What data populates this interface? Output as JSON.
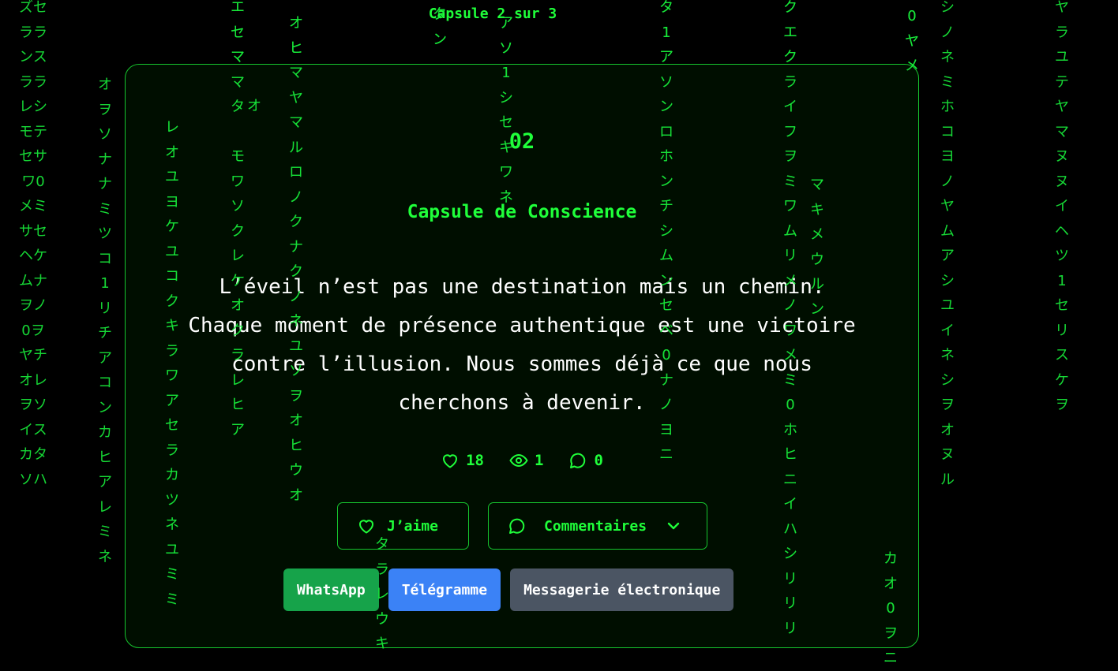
{
  "header": {
    "counter": "Capsule 2 sur 3"
  },
  "capsule": {
    "number": "02",
    "title": "Capsule de Conscience",
    "quote_lines": [
      "L’éveil n’est pas une destination mais un chemin.",
      "Chaque moment de présence authentique est une victoire",
      "contre l’illusion. Nous sommes déjà ce que nous",
      "cherchons à devenir."
    ]
  },
  "stats": {
    "likes": "18",
    "views": "1",
    "comments": "0"
  },
  "actions": {
    "like_label": "J’aime",
    "comments_label": "Commentaires"
  },
  "share": {
    "whatsapp": "WhatsApp",
    "telegram": "Télégramme",
    "email": "Messagerie électronique"
  },
  "icons": {
    "likes": "heart-icon",
    "views": "eye-icon",
    "comments": "chat-bubble-icon",
    "toggle": "chevron-down-icon"
  },
  "colors": {
    "background": "#000000",
    "accent": "#1fff3a",
    "border": "#16c52e",
    "quote": "#ffffff",
    "whatsapp": "#16a34a",
    "telegram": "#3b82f6",
    "email": "#4b5563"
  },
  "rain": [
    {
      "text": "ズセ\nララ\nンス\nララ\nレシ\nモテ\nセサ\nワ0\nメミ\nサセ\nヘケ\nムナ\nヲノ\n0ヲ\nヤチ\nオレ\nヲソ\nイス\nカタ\nソハ"
    },
    {
      "text": "オ\nヲ\nソ\nナ\nナ\nミ\nツ\nコ\n1\nリ\nチ\nア\nコ\nン\nカ\nヒ\nア\nレ\nミ\nネ"
    },
    {
      "text": "レ\nオ\nユ\nヨ\nケ\nユ\nコ\nク\nキ\nラ\nワ\nア\nセ\nラ\nカ\nツ\nネ\nユ\nミ\nミ"
    },
    {
      "text": "エ\nセ\nマ\nマ\nタ\n \nモ\nワ\nソ\nク\nレ\nケ\nオ\nク\nラ\nレ\nヒ\nア"
    },
    {
      "text": "オ"
    },
    {
      "text": "オ\nヒ\nマ\nヤ\nマ\nル\nロ\nノ\nク\nナ\nク\nノ\nネ\nユ\nソ\nヲ\nオ\nヒ\nウ\nオ"
    },
    {
      "text": "タ\nラ\nレ\nウ\nキ"
    },
    {
      "text": "タ\nン"
    },
    {
      "text": "ア\nソ\n1\nシ\nセ\nキ\nワ\nネ"
    },
    {
      "text": "タ\n1\nア\nソ\nン\nロ\nホ\nン\nチ\nシ\nム\nン\nセ\nベ\n0\nナ\nノ\nヨ\nニ"
    },
    {
      "text": "ク\nエ\nク\nラ\nイ\nフ\nヲ\nミ\nワ\nム\nリ\nメ\nノ\nワ\nメ\nミ\n0\nホ\nヒ\nニ\nイ\nハ\nシ\nリ\nリ\nリ"
    },
    {
      "text": "マ\nキ\nメ\nウ\nル\nン"
    },
    {
      "text": "カ\nオ\n0\nヲ\nニ"
    },
    {
      "text": "0\nヤ\nメ"
    },
    {
      "text": "シ\nノ\nネ\nミ\nホ\nコ\nヨ\nノ\nヤ\nム\nア\nシ\nユ\nイ\nネ\nシ\nヲ\nオ\nヌ\nル"
    },
    {
      "text": "ヤ\nラ\nユ\nテ\nヤ\nマ\nヌ\nヌ\nイ\nヘ\nツ\n1\nセ\nリ\nス\nケ\nヲ"
    }
  ]
}
